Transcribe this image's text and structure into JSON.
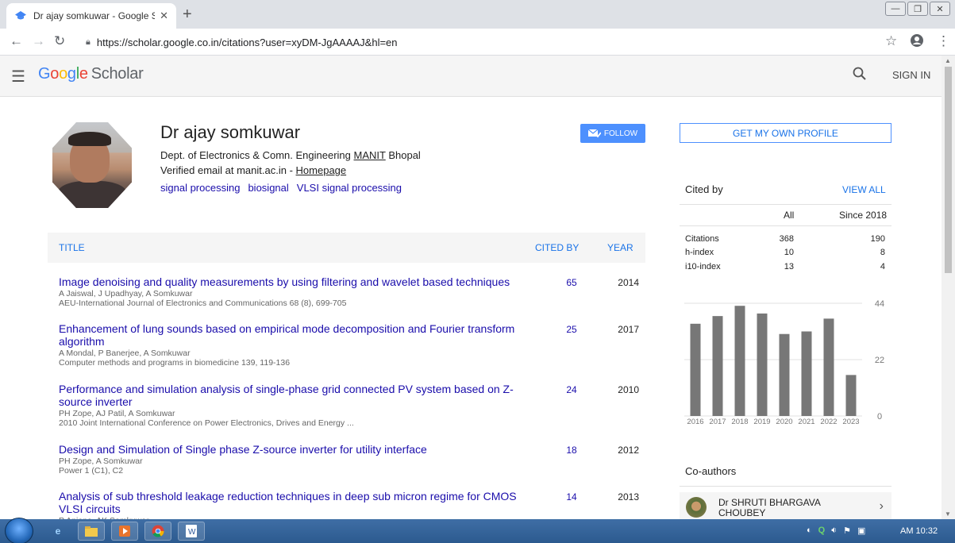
{
  "browser": {
    "tab_title": "Dr ajay somkuwar - Google Scho",
    "url": "https://scholar.google.co.in/citations?user=xyDM-JgAAAAJ&hl=en"
  },
  "header": {
    "logo_google": [
      "G",
      "o",
      "o",
      "g",
      "l",
      "e"
    ],
    "logo_scholar": "Scholar",
    "signin": "SIGN IN"
  },
  "profile": {
    "name": "Dr ajay somkuwar",
    "affiliation_prefix": "Dept. of Electronics & Comn. Engineering ",
    "affiliation_link": "MANIT",
    "affiliation_suffix": " Bhopal",
    "email_prefix": "Verified email at manit.ac.in - ",
    "homepage": "Homepage",
    "interests": [
      "signal processing",
      "biosignal",
      "VLSI signal processing"
    ],
    "follow": "FOLLOW"
  },
  "table": {
    "col_title": "TITLE",
    "col_cited": "CITED BY",
    "col_year": "YEAR",
    "rows": [
      {
        "title": "Image denoising and quality measurements by using filtering and wavelet based techniques",
        "authors": "A Jaiswal, J Upadhyay, A Somkuwar",
        "venue": "AEU-International Journal of Electronics and Communications 68 (8), 699-705",
        "cited": "65",
        "year": "2014"
      },
      {
        "title": "Enhancement of lung sounds based on empirical mode decomposition and Fourier transform algorithm",
        "authors": "A Mondal, P Banerjee, A Somkuwar",
        "venue": "Computer methods and programs in biomedicine 139, 119-136",
        "cited": "25",
        "year": "2017"
      },
      {
        "title": "Performance and simulation analysis of single-phase grid connected PV system based on Z-source inverter",
        "authors": "PH Zope, AJ Patil, A Somkuwar",
        "venue": "2010 Joint International Conference on Power Electronics, Drives and Energy ...",
        "cited": "24",
        "year": "2010"
      },
      {
        "title": "Design and Simulation of Single phase Z-source inverter for utility interface",
        "authors": "PH Zope, A Somkuwar",
        "venue": "Power 1 (C1), C2",
        "cited": "18",
        "year": "2012"
      },
      {
        "title": "Analysis of sub threshold leakage reduction techniques in deep sub micron regime for CMOS VLSI circuits",
        "authors": "P Anjana, AK Somkuwar",
        "venue": "",
        "cited": "14",
        "year": "2013"
      }
    ]
  },
  "sidebar": {
    "get_profile": "GET MY OWN PROFILE",
    "cited_by": "Cited by",
    "view_all": "VIEW ALL",
    "col_all": "All",
    "col_since": "Since 2018",
    "stats": [
      {
        "label": "Citations",
        "all": "368",
        "since": "190"
      },
      {
        "label": "h-index",
        "all": "10",
        "since": "8"
      },
      {
        "label": "i10-index",
        "all": "13",
        "since": "4"
      }
    ],
    "coauthors_title": "Co-authors",
    "coauthor_name": "Dr SHRUTI BHARGAVA CHOUBEY"
  },
  "chart_data": {
    "type": "bar",
    "categories": [
      "2016",
      "2017",
      "2018",
      "2019",
      "2020",
      "2021",
      "2022",
      "2023"
    ],
    "values": [
      36,
      39,
      43,
      40,
      32,
      33,
      38,
      16
    ],
    "ylim": [
      0,
      44
    ],
    "yticks": [
      "0",
      "22",
      "44"
    ],
    "bar_color": "#777777"
  },
  "taskbar": {
    "clock": "AM 10:32"
  }
}
